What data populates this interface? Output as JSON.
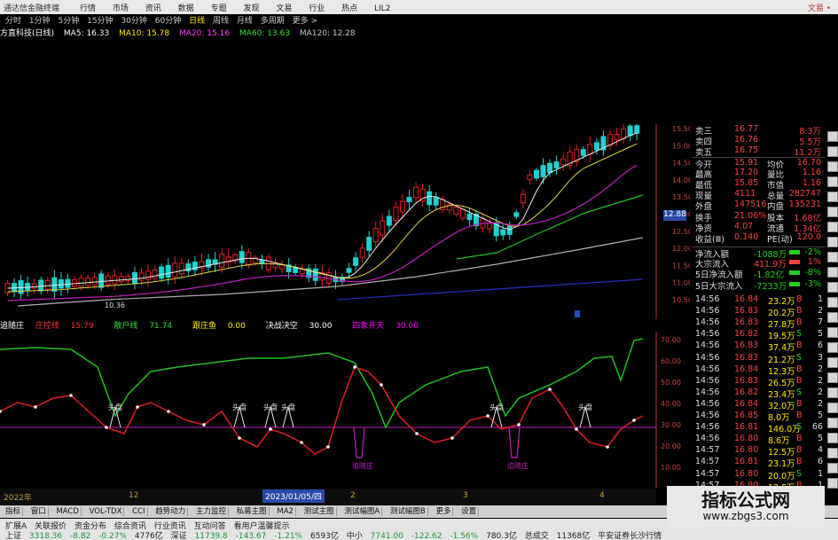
{
  "menubar": {
    "app_title": "通达信金融终端",
    "items": [
      "行情",
      "市场",
      "资讯",
      "数据",
      "专题",
      "发现",
      "文易",
      "行业",
      "热点",
      "LIL2"
    ],
    "right_label": "文易 •"
  },
  "period_tabs": {
    "items": [
      "分时",
      "1分钟",
      "5分钟",
      "15分钟",
      "30分钟",
      "60分钟",
      "日线",
      "周线",
      "月线",
      "多周期",
      "更多 >"
    ],
    "active_index": 6
  },
  "ma_bar": {
    "name": "方直科技(日线)",
    "ma5": "MA5: 16.33",
    "ma10": "MA10: 15.78",
    "ma20": "MA20: 15.16",
    "ma60": "MA60: 13.63",
    "ma120": "MA120: 12.28"
  },
  "price_axis": {
    "labels": [
      "15.50",
      "15.00",
      "14.50",
      "14.00",
      "13.50",
      "13.00",
      "12.50",
      "12.00",
      "11.50",
      "11.00",
      "10.50"
    ],
    "low_label": "10.36",
    "mid_price": "12.88"
  },
  "indicator": {
    "name": "追随庄",
    "items": [
      {
        "label": "庄控线",
        "value": "15.79",
        "color": "#ff3030"
      },
      {
        "label": "散户线",
        "value": "71.74",
        "color": "#30e030"
      },
      {
        "label": "跟庄鱼",
        "value": "0.00",
        "color": "#ffea00"
      },
      {
        "label": "决战决空",
        "value": "30.00",
        "color": "#ffffff"
      },
      {
        "label": "四象开天",
        "value": "30.00",
        "color": "#ff00ff"
      }
    ],
    "axis": [
      "70.00",
      "60.00",
      "50.00",
      "40.00",
      "30.00",
      "20.00",
      "10.00"
    ],
    "top_label": "头盘",
    "bottom_label": "追随庄"
  },
  "time_axis": {
    "left_label": "2022年",
    "highlight": "2023/01/05/四",
    "marks": [
      "12",
      "2",
      "3",
      "4"
    ]
  },
  "quote": [
    {
      "label": "卖三",
      "price": "16.77",
      "vol": "8.3万"
    },
    {
      "label": "卖四",
      "price": "16.76",
      "vol": "5.5万"
    },
    {
      "label": "卖五",
      "price": "16.75",
      "vol": "11.2万"
    },
    {
      "label": "今开",
      "price": "15.91",
      "label2": "均价",
      "vol": "16.70"
    },
    {
      "label": "最高",
      "price": "17.20",
      "label2": "量比",
      "vol": "1.16"
    },
    {
      "label": "最低",
      "price": "15.85",
      "label2": "市值",
      "vol": "1.16"
    },
    {
      "label": "现量",
      "price": "4111",
      "label2": "总量",
      "vol": "282747"
    },
    {
      "label": "外盘",
      "price": "147516",
      "label2": "内盘",
      "vol": "135231"
    },
    {
      "label": "换手",
      "price": "21.06%",
      "label2": "股本",
      "vol": "1.68亿"
    },
    {
      "label": "净资",
      "price": "4.07",
      "label2": "流通",
      "vol": "1.34亿"
    },
    {
      "label": "收益(Ⅲ)",
      "price": "0.140",
      "label2": "PE(动)",
      "vol": "120.0"
    }
  ],
  "flows": [
    {
      "label": "净流入额",
      "value": "-1088万",
      "pct": "-2%"
    },
    {
      "label": "大宗流入",
      "value": "411.9万",
      "pct": "1%"
    },
    {
      "label": "5日净流入额",
      "value": "-1.82亿",
      "pct": "-8%"
    },
    {
      "label": "5日大宗流入",
      "value": "-7233万",
      "pct": "-3%"
    }
  ],
  "ticks": [
    {
      "time": "14:56",
      "price": "16.84",
      "vol": "23.2万",
      "side": "B",
      "num": "1"
    },
    {
      "time": "14:56",
      "price": "16.83",
      "vol": "20.2万",
      "side": "B",
      "num": "2"
    },
    {
      "time": "14:56",
      "price": "16.83",
      "vol": "27.8万",
      "side": "B",
      "num": "7"
    },
    {
      "time": "14:56",
      "price": "16.82",
      "vol": "19.5万",
      "side": "S",
      "num": "5"
    },
    {
      "time": "14:56",
      "price": "16.83",
      "vol": "37.4万",
      "side": "B",
      "num": "6"
    },
    {
      "time": "14:56",
      "price": "16.83",
      "vol": "21.2万",
      "side": "S",
      "num": "3"
    },
    {
      "time": "14:56",
      "price": "16.84",
      "vol": "12.3万",
      "side": "B",
      "num": "2"
    },
    {
      "time": "14:56",
      "price": "16.83",
      "vol": "26.5万",
      "side": "B",
      "num": "2"
    },
    {
      "time": "14:56",
      "price": "16.82",
      "vol": "23.4万",
      "side": "S",
      "num": "2"
    },
    {
      "time": "14:56",
      "price": "16.84",
      "vol": "32.0万",
      "side": "B",
      "num": "2"
    },
    {
      "time": "14:56",
      "price": "16.85",
      "vol": "8.0万",
      "side": "B",
      "num": "5"
    },
    {
      "time": "14:56",
      "price": "16.81",
      "vol": "146.0万",
      "side": "S",
      "num": "66"
    },
    {
      "time": "14:56",
      "price": "16.80",
      "vol": "8.6万",
      "side": "B",
      "num": "5"
    },
    {
      "time": "14:57",
      "price": "16.80",
      "vol": "12.5万",
      "side": "B",
      "num": "4"
    },
    {
      "time": "14:57",
      "price": "16.81",
      "vol": "23.1万",
      "side": "B",
      "num": "6"
    },
    {
      "time": "14:57",
      "price": "16.80",
      "vol": "20.0万",
      "side": "S",
      "num": "1"
    },
    {
      "time": "14:57",
      "price": "16.80",
      "vol": "12.5万",
      "side": "B",
      "num": "1"
    }
  ],
  "tabs_bar": {
    "items": [
      "指标",
      "窗口",
      "MACD",
      "VOL-TDX",
      "CCI",
      "趋势动力",
      "主力监控",
      "私募主图",
      "MA2",
      "测试主图",
      "测试幅图A",
      "测试幅图B",
      "更多",
      "设置"
    ],
    "left_items": [
      "扩展A",
      "关联报价",
      "资金分布",
      "综合资讯",
      "行业资讯",
      "互动问答",
      "看用户温馨提示"
    ]
  },
  "bottom_bar": {
    "items": [
      {
        "name": "上证",
        "value": "3318.36",
        "chg": "-8.82",
        "pct": "-0.27%",
        "amt": "4776亿"
      },
      {
        "name": "深证",
        "value": "11739.8",
        "chg": "-143.67",
        "pct": "-1.21%",
        "amt": "6593亿"
      },
      {
        "name": "中小",
        "value": "7741.00",
        "chg": "-122.62",
        "pct": "-1.56%",
        "amt": "780.3亿"
      }
    ],
    "total_label": "总成交",
    "total": "11368亿",
    "news": "平安证券长沙行情"
  },
  "watermark": {
    "title": "指标公式网",
    "url": "www.zbgs3.com"
  }
}
